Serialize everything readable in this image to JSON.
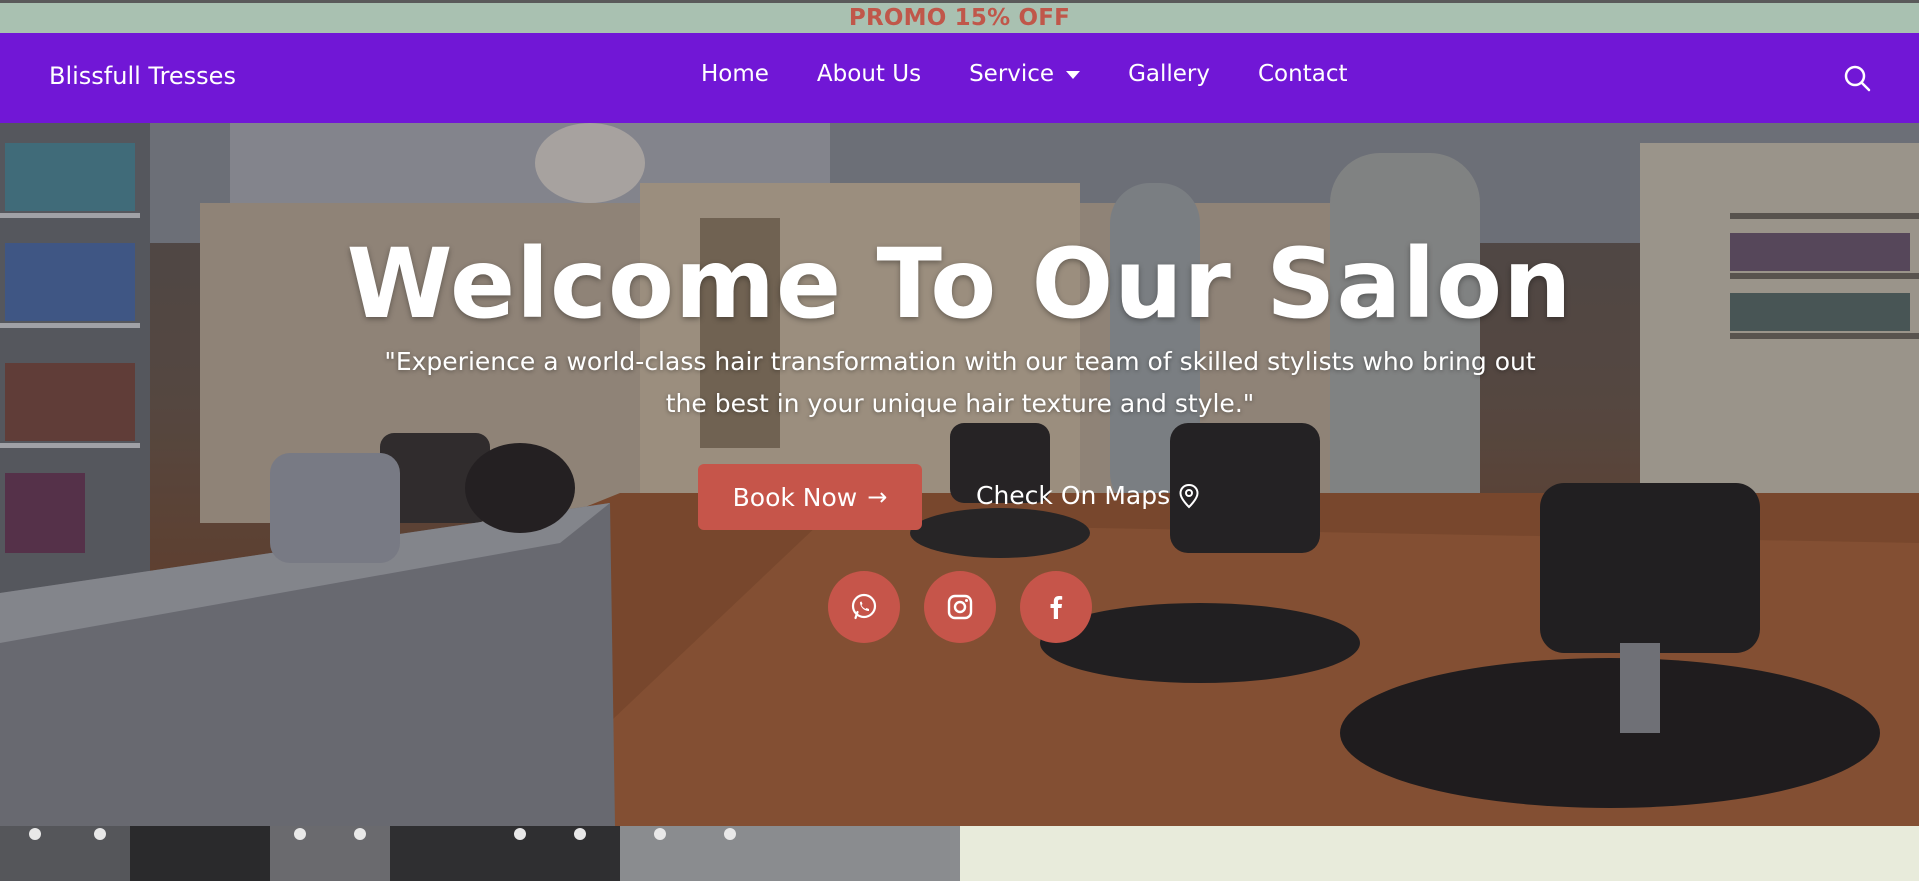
{
  "promo": {
    "text": "PROMO 15% OFF"
  },
  "nav": {
    "brand": "Blissfull Tresses",
    "items": [
      {
        "label": "Home"
      },
      {
        "label": "About Us"
      },
      {
        "label": "Service",
        "has_dropdown": true
      },
      {
        "label": "Gallery"
      },
      {
        "label": "Contact"
      }
    ],
    "search_icon": "search-icon"
  },
  "hero": {
    "title": "Welcome To Our Salon",
    "subtitle": "\"Experience a world-class hair transformation with our team of skilled stylists who bring out the best in your unique hair texture and style.\"",
    "book_label": "Book Now",
    "book_arrow": "→",
    "maps_label": "Check On Maps",
    "social": [
      "whatsapp-icon",
      "instagram-icon",
      "facebook-icon"
    ]
  },
  "colors": {
    "promo_bg": "#a9c1b1",
    "promo_text": "#c0574a",
    "nav_bg": "#7117d6",
    "accent": "#c6554a",
    "lower_right_bg": "#e8ebdb"
  }
}
